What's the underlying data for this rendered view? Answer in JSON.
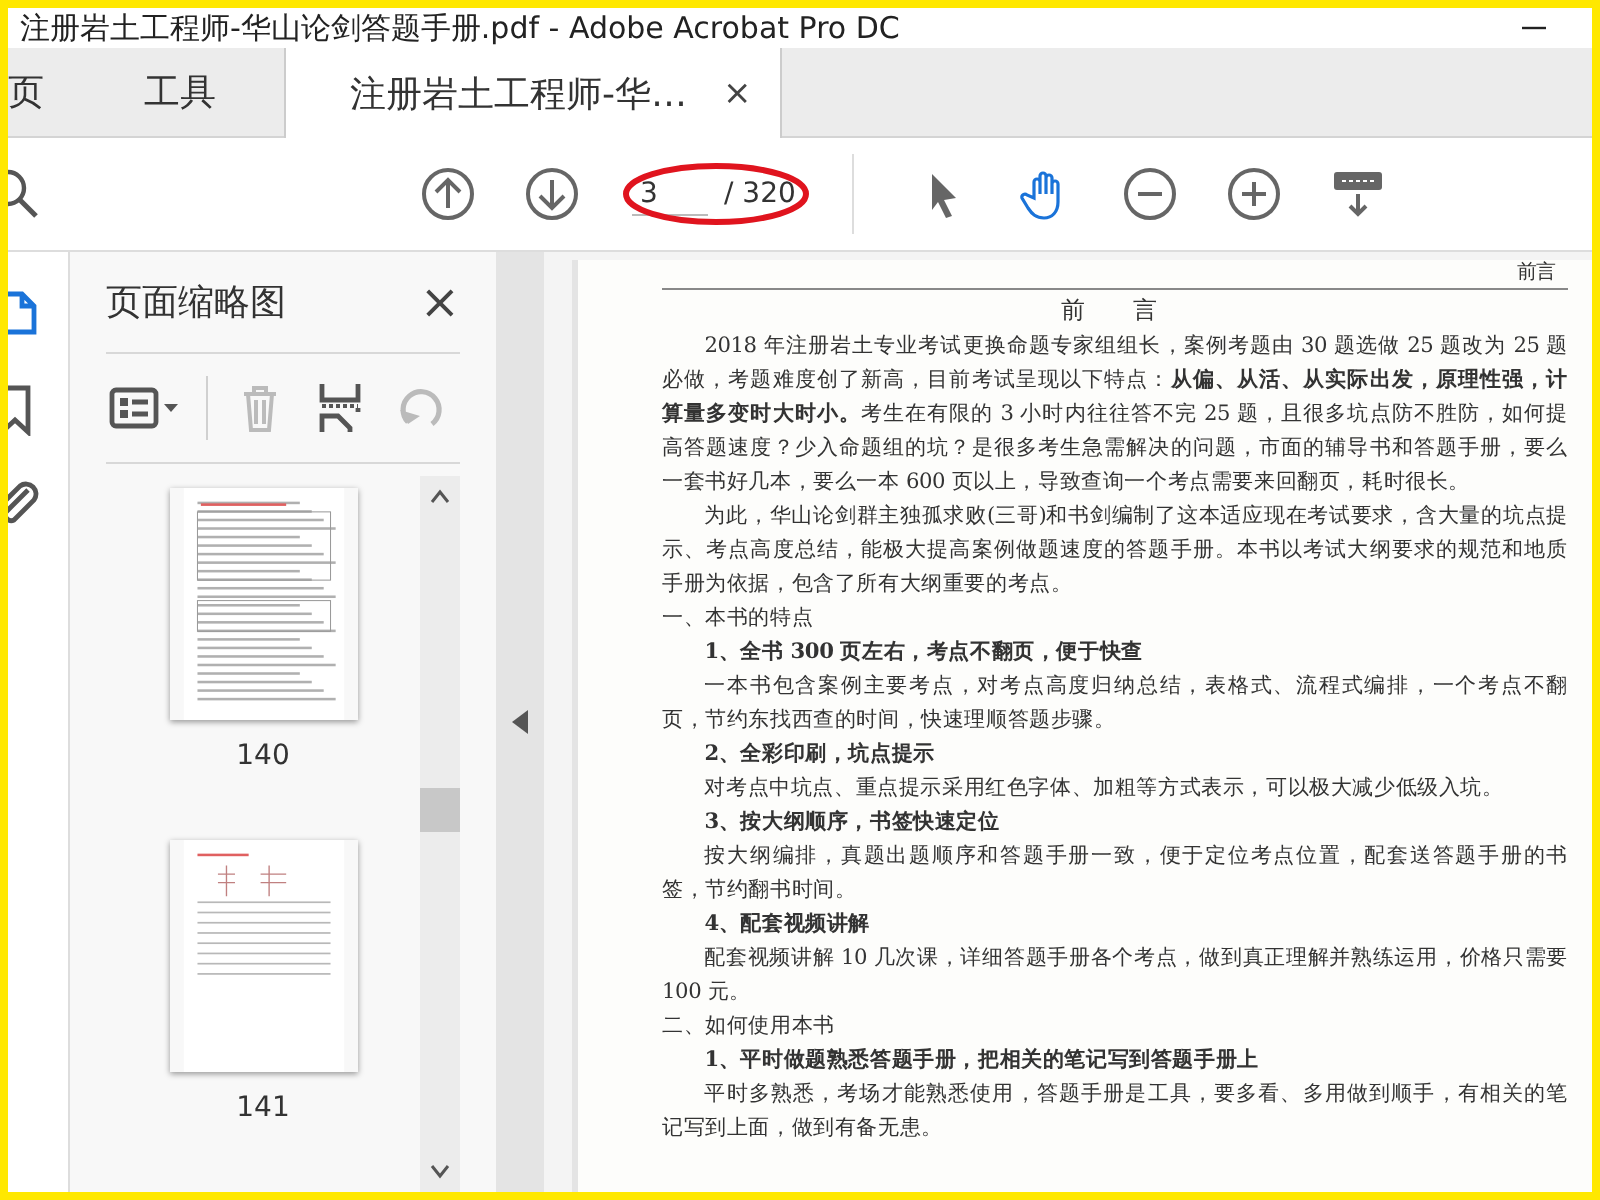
{
  "window": {
    "title": "注册岩土工程师-华山论剑答题手册.pdf - Adobe Acrobat Pro DC"
  },
  "tabs": [
    {
      "label": "页",
      "selected": false
    },
    {
      "label": "工具",
      "selected": false
    },
    {
      "label": "注册岩土工程师-华…",
      "selected": true,
      "close": "×"
    }
  ],
  "toolbar": {
    "tools": [
      {
        "kind": "prev"
      },
      {
        "kind": "next"
      },
      {
        "kind": "page"
      },
      {
        "kind": "select",
        "selected": false
      },
      {
        "kind": "hand",
        "selected": true
      },
      {
        "kind": "zoom-out"
      },
      {
        "kind": "zoom-in"
      },
      {
        "kind": "read-mode"
      }
    ],
    "page_field": {
      "value": "3",
      "total": "/ 320"
    }
  },
  "sidebar": {
    "items": [
      {
        "kind": "thumbnails",
        "selected": true
      },
      {
        "kind": "bookmarks",
        "selected": false
      },
      {
        "kind": "attachments",
        "selected": false
      }
    ]
  },
  "panel": {
    "title": "页面缩略图",
    "close": "×",
    "tools": [
      {
        "kind": "options",
        "disabled": false
      },
      {
        "kind": "delete",
        "disabled": true
      },
      {
        "kind": "insert",
        "disabled": false
      },
      {
        "kind": "rotate",
        "disabled": true
      }
    ],
    "thumbnails": [
      {
        "label": "140",
        "kind": "tables"
      },
      {
        "label": "141",
        "kind": "diagram"
      }
    ]
  },
  "document": {
    "running_head": "前言",
    "title": "前　言",
    "paragraphs": [
      {
        "kind": "body",
        "text": "2018 年注册岩土专业考试更换命题专家组组长，案例考题由 30 题选做 25 题改为 25 题必做，考题难度创了新高，目前考试呈现以下特点：**从偏、从活、从实际出发，原理性强，计算量多变时大时小。**考生在有限的 3 小时内往往答不完 25 题，且很多坑点防不胜防，如何提高答题速度？少入命题组的坑？是很多考生急需解决的问题，市面的辅导书和答题手册，要么一套书好几本，要么一本 600 页以上，导致查询一个考点需要来回翻页，耗时很长。"
      },
      {
        "kind": "body",
        "text": "为此，华山论剑群主独孤求败(三哥)和书剑编制了这本适应现在考试要求，含大量的坑点提示、考点高度总结，能极大提高案例做题速度的答题手册。本书以考试大纲要求的规范和地质手册为依据，包含了所有大纲重要的考点。"
      },
      {
        "kind": "heading",
        "text": "一、本书的特点"
      },
      {
        "kind": "subheading",
        "text": "1、全书 300 页左右，考点不翻页，便于快查"
      },
      {
        "kind": "body",
        "text": "一本书包含案例主要考点，对考点高度归纳总结，表格式、流程式编排，一个考点不翻页，节约东找西查的时间，快速理顺答题步骤。"
      },
      {
        "kind": "subheading",
        "text": "2、全彩印刷，坑点提示"
      },
      {
        "kind": "body",
        "text": "对考点中坑点、重点提示采用红色字体、加粗等方式表示，可以极大减少低级入坑。"
      },
      {
        "kind": "subheading",
        "text": "3、按大纲顺序，书签快速定位"
      },
      {
        "kind": "body",
        "text": "按大纲编排，真题出题顺序和答题手册一致，便于定位考点位置，配套送答题手册的书签，节约翻书时间。"
      },
      {
        "kind": "subheading",
        "text": "4、配套视频讲解"
      },
      {
        "kind": "body",
        "text": "配套视频讲解 10 几次课，详细答题手册各个考点，做到真正理解并熟练运用，价格只需要 100 元。"
      },
      {
        "kind": "heading",
        "text": "二、如何使用本书"
      },
      {
        "kind": "subheading",
        "text": "1、平时做题熟悉答题手册，把相关的笔记写到答题手册上"
      },
      {
        "kind": "body",
        "text": "平时多熟悉，考场才能熟悉使用，答题手册是工具，要多看、多用做到顺手，有相关的笔记写到上面，做到有备无患。"
      }
    ]
  }
}
